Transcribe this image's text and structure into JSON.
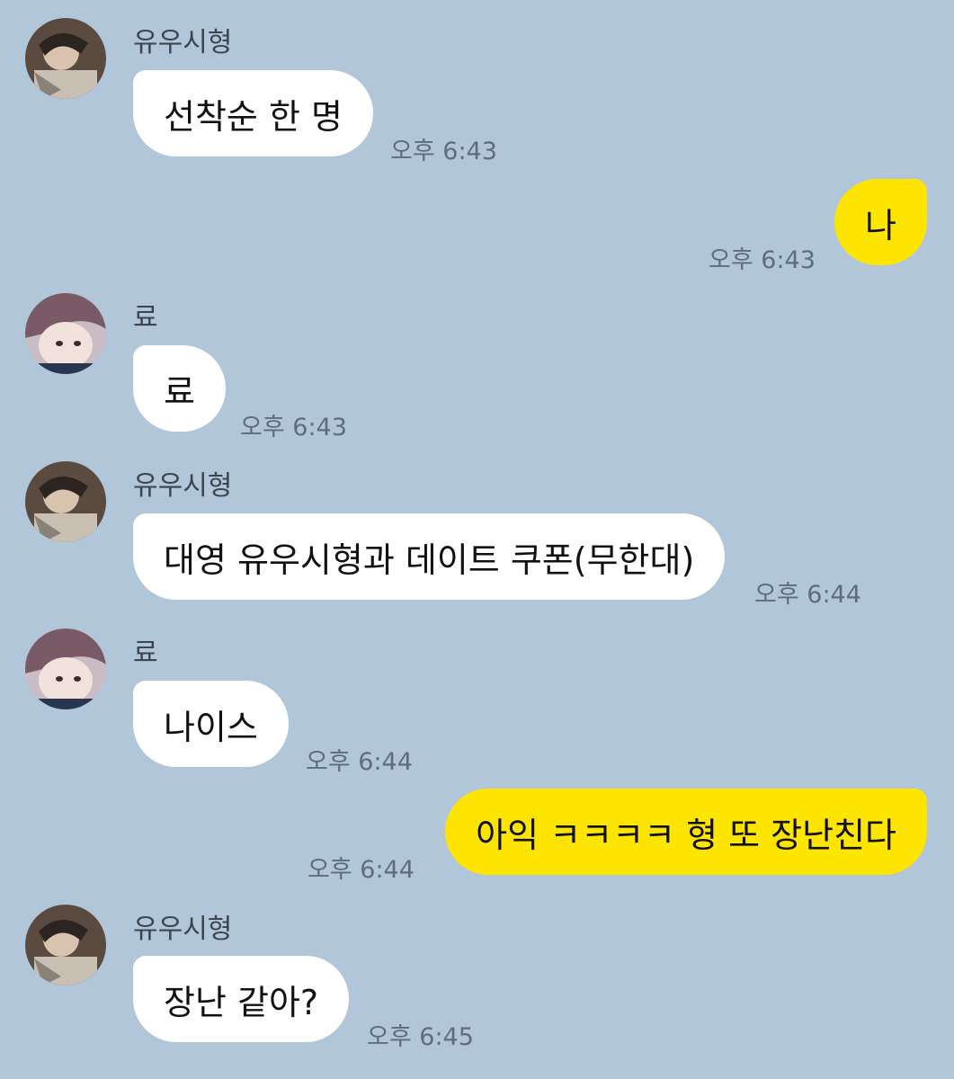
{
  "colors": {
    "background": "#b2c6da",
    "incoming_bubble": "#ffffff",
    "outgoing_bubble": "#fde500"
  },
  "messages": [
    {
      "sender": "유우시형",
      "avatar": "avatar-yuushi",
      "text": "선착순 한 명",
      "time": "오후 6:43",
      "outgoing": false
    },
    {
      "text": "나",
      "time": "오후 6:43",
      "outgoing": true
    },
    {
      "sender": "료",
      "avatar": "avatar-ryo",
      "text": "료",
      "time": "오후 6:43",
      "outgoing": false
    },
    {
      "sender": "유우시형",
      "avatar": "avatar-yuushi",
      "text": "대영 유우시형과 데이트 쿠폰(무한대)",
      "time": "오후 6:44",
      "outgoing": false
    },
    {
      "sender": "료",
      "avatar": "avatar-ryo",
      "text": "나이스",
      "time": "오후 6:44",
      "outgoing": false
    },
    {
      "text": "아익 ㅋㅋㅋㅋ 형 또 장난친다",
      "time": "오후 6:44",
      "outgoing": true
    },
    {
      "sender": "유우시형",
      "avatar": "avatar-yuushi",
      "text": "장난 같아?",
      "time": "오후 6:45",
      "outgoing": false
    }
  ]
}
